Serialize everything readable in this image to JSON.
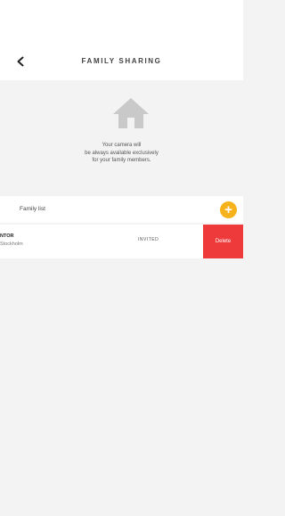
{
  "header": {
    "title": "FAMILY SHARING",
    "back_icon": "chevron-left-icon"
  },
  "hero": {
    "icon": "house-icon",
    "lines": [
      "Your camera will",
      "be always available exclusively",
      "for your family members."
    ]
  },
  "family_list": {
    "label": "Family list",
    "add_icon": "plus-icon",
    "members": [
      {
        "name": "NTOR",
        "subtitle": "Stockholm",
        "status": "INVITED",
        "delete_label": "Delete"
      }
    ]
  },
  "colors": {
    "accent": "#f6b21a",
    "danger": "#ee3a3a",
    "background": "#f3f3f3"
  }
}
